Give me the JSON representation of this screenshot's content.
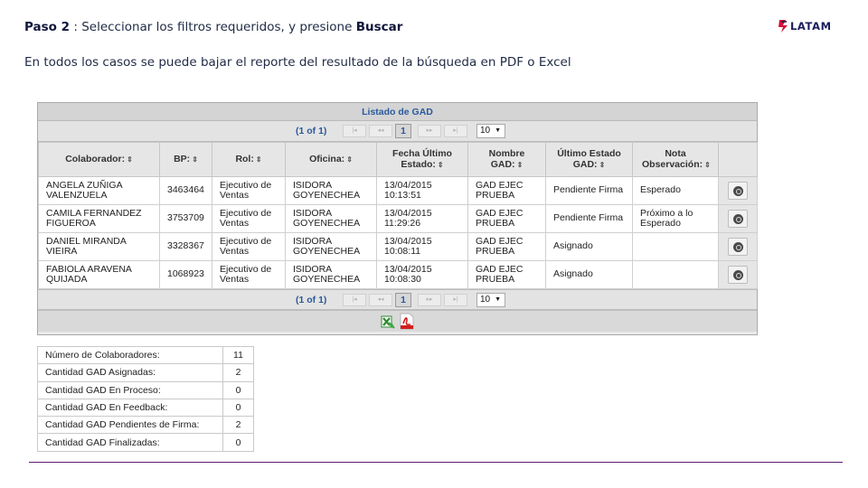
{
  "header": {
    "step_label": "Paso 2",
    "step_sep": " : ",
    "step_text": "Seleccionar los filtros requeridos, y presione ",
    "step_action": "Buscar",
    "subtitle": "En todos los casos se puede bajar el reporte del resultado de la búsqueda  en PDF o Excel",
    "logo_text": "LATAM",
    "logo_color": "#1b1d5c",
    "logo_accent": "#d0113a"
  },
  "grid": {
    "title": "Listado de GAD",
    "pager": {
      "info": "(1 of 1)",
      "first": "|◂",
      "prev": "◂◂",
      "current": "1",
      "next": "▸▸",
      "last": "▸|",
      "rows_per_page": "10",
      "caret": "▼"
    },
    "columns": [
      {
        "label": "Colaborador:",
        "sort": "⇕"
      },
      {
        "label": "BP:",
        "sort": "⇕"
      },
      {
        "label": "Rol:",
        "sort": "⇕"
      },
      {
        "label": "Oficina:",
        "sort": "⇕"
      },
      {
        "label": "Fecha Último Estado:",
        "sort": "⇕"
      },
      {
        "label": "Nombre GAD:",
        "sort": "⇕"
      },
      {
        "label": "Último Estado GAD:",
        "sort": "⇕"
      },
      {
        "label": "Nota Observación:",
        "sort": "⇕"
      },
      {
        "label": ""
      }
    ],
    "rows": [
      {
        "colaborador": "ANGELA ZUÑIGA VALENZUELA",
        "bp": "3463464",
        "rol": "Ejecutivo de Ventas",
        "oficina": "ISIDORA GOYENECHEA",
        "fecha": "13/04/2015 10:13:51",
        "nombre": "GAD EJEC PRUEBA",
        "estado": "Pendiente Firma",
        "nota": "Esperado"
      },
      {
        "colaborador": "CAMILA FERNANDEZ FIGUEROA",
        "bp": "3753709",
        "rol": "Ejecutivo de Ventas",
        "oficina": "ISIDORA GOYENECHEA",
        "fecha": "13/04/2015 11:29:26",
        "nombre": "GAD EJEC PRUEBA",
        "estado": "Pendiente Firma",
        "nota": "Próximo a lo Esperado"
      },
      {
        "colaborador": "DANIEL MIRANDA VIEIRA",
        "bp": "3328367",
        "rol": "Ejecutivo de Ventas",
        "oficina": "ISIDORA GOYENECHEA",
        "fecha": "13/04/2015 10:08:11",
        "nombre": "GAD EJEC PRUEBA",
        "estado": "Asignado",
        "nota": ""
      },
      {
        "colaborador": "FABIOLA ARAVENA QUIJADA",
        "bp": "1068923",
        "rol": "Ejecutivo de Ventas",
        "oficina": "ISIDORA GOYENECHEA",
        "fecha": "13/04/2015 10:08:30",
        "nombre": "GAD EJEC PRUEBA",
        "estado": "Asignado",
        "nota": ""
      }
    ],
    "export_icons": [
      "excel-export-icon",
      "pdf-export-icon"
    ]
  },
  "summary": [
    {
      "label": "Número de Colaboradores:",
      "value": "11"
    },
    {
      "label": "Cantidad GAD Asignadas:",
      "value": "2"
    },
    {
      "label": "Cantidad GAD En Proceso:",
      "value": "0"
    },
    {
      "label": "Cantidad GAD En Feedback:",
      "value": "0"
    },
    {
      "label": "Cantidad GAD Pendientes de Firma:",
      "value": "2"
    },
    {
      "label": "Cantidad GAD Finalizadas:",
      "value": "0"
    }
  ]
}
